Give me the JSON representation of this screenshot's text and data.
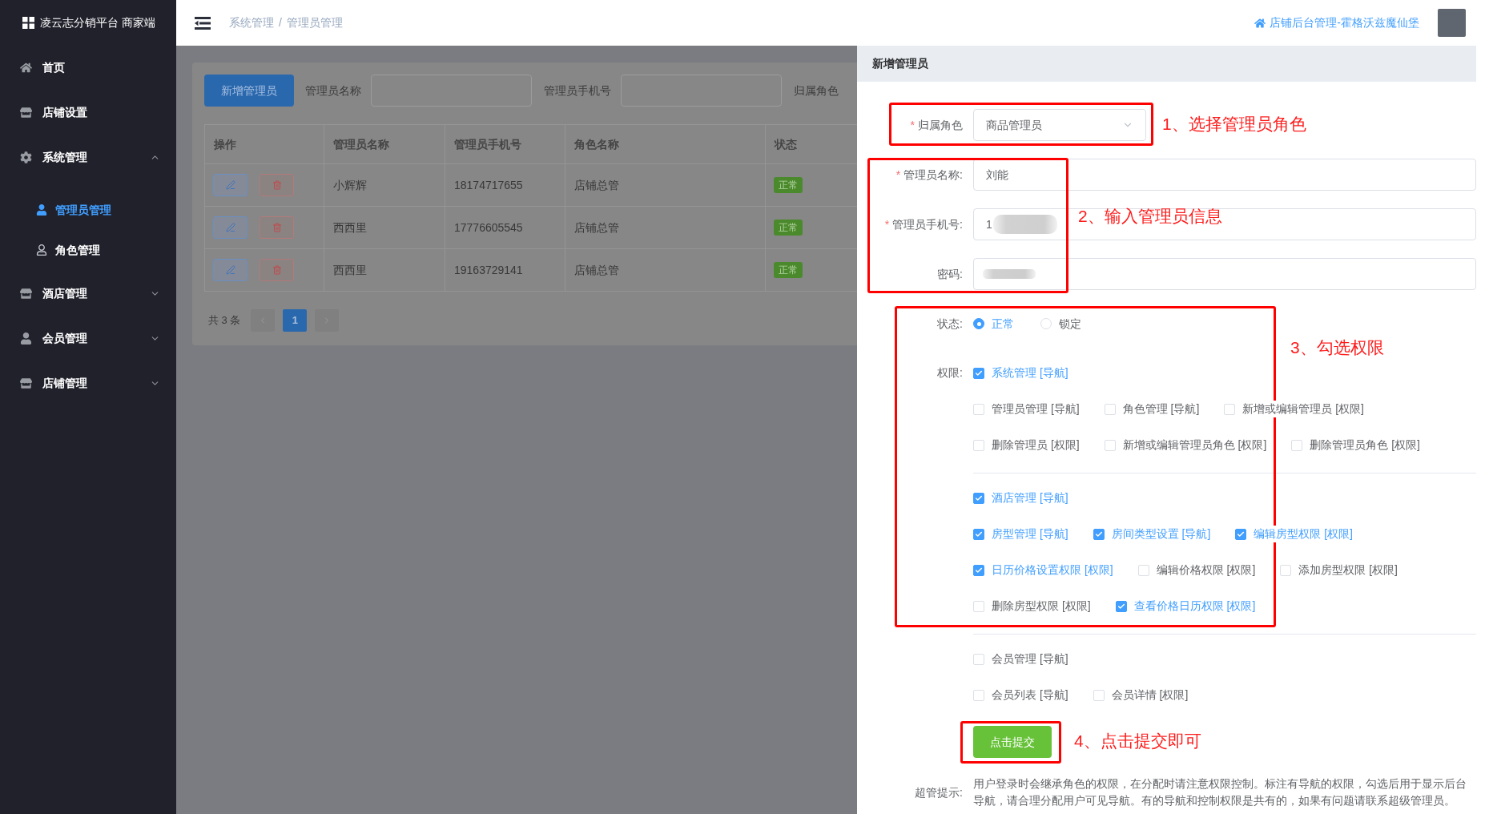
{
  "sidebar": {
    "app_title": "凌云志分销平台 商家端",
    "items": [
      {
        "label": "首页",
        "kind": "link"
      },
      {
        "label": "店铺设置",
        "kind": "link"
      },
      {
        "label": "系统管理",
        "kind": "submenu",
        "expanded": true,
        "children": [
          {
            "label": "管理员管理",
            "selected": true
          },
          {
            "label": "角色管理",
            "selected": false
          }
        ]
      },
      {
        "label": "酒店管理",
        "kind": "submenu",
        "expanded": false
      },
      {
        "label": "会员管理",
        "kind": "submenu",
        "expanded": false
      },
      {
        "label": "店铺管理",
        "kind": "submenu",
        "expanded": false
      }
    ]
  },
  "header": {
    "breadcrumb": {
      "items": [
        "系统管理",
        "管理员管理"
      ],
      "separator": "/"
    },
    "shop_link": "店铺后台管理-霍格沃兹魔仙堡"
  },
  "main": {
    "add_button": "新增管理员",
    "filters": [
      {
        "label": "管理员名称",
        "kind": "input"
      },
      {
        "label": "管理员手机号",
        "kind": "input"
      },
      {
        "label": "归属角色",
        "kind": "label"
      }
    ],
    "table": {
      "columns": [
        "操作",
        "管理员名称",
        "管理员手机号",
        "角色名称",
        "状态"
      ],
      "rows": [
        {
          "name": "小辉辉",
          "phone": "18174717655",
          "role": "店铺总管",
          "status": "正常"
        },
        {
          "name": "西西里",
          "phone": "17776605545",
          "role": "店铺总管",
          "status": "正常"
        },
        {
          "name": "西西里",
          "phone": "19163729141",
          "role": "店铺总管",
          "status": "正常"
        }
      ]
    },
    "pagination": {
      "total": "共 3 条",
      "pages": [
        {
          "label": "1",
          "selected": true
        }
      ]
    }
  },
  "drawer": {
    "title": "新增管理员",
    "fields": [
      {
        "kind": "select",
        "label": "归属角色",
        "required_mark": "*",
        "value": "商品管理员"
      },
      {
        "kind": "input",
        "label": "管理员名称:",
        "required_mark": "*",
        "value": "刘能"
      },
      {
        "kind": "input",
        "label": "管理员手机号:",
        "required_mark": "*",
        "value": "1",
        "redacted": true
      },
      {
        "kind": "input",
        "label": "密码:",
        "redacted": true
      }
    ],
    "status": {
      "label": "状态:",
      "options": [
        {
          "label": "正常",
          "selected": true
        },
        {
          "label": "锁定",
          "selected": false
        }
      ]
    },
    "permissions": {
      "label": "权限:",
      "groups": [
        {
          "label": "系统管理 [导航]",
          "checked": true,
          "children": [
            {
              "label": "管理员管理 [导航]",
              "checked": false
            },
            {
              "label": "角色管理 [导航]",
              "checked": false
            },
            {
              "label": "新增或编辑管理员 [权限]",
              "checked": false
            },
            {
              "label": "删除管理员 [权限]",
              "checked": false
            },
            {
              "label": "新增或编辑管理员角色 [权限]",
              "checked": false
            },
            {
              "label": "删除管理员角色 [权限]",
              "checked": false
            }
          ]
        },
        {
          "label": "酒店管理 [导航]",
          "checked": true,
          "children": [
            {
              "label": "房型管理 [导航]",
              "checked": true
            },
            {
              "label": "房间类型设置 [导航]",
              "checked": true
            },
            {
              "label": "编辑房型权限 [权限]",
              "checked": true
            },
            {
              "label": "日历价格设置权限 [权限]",
              "checked": true
            },
            {
              "label": "编辑价格权限 [权限]",
              "checked": false
            },
            {
              "label": "添加房型权限 [权限]",
              "checked": false
            },
            {
              "label": "删除房型权限 [权限]",
              "checked": false
            },
            {
              "label": "查看价格日历权限 [权限]",
              "checked": true
            }
          ]
        },
        {
          "label": "会员管理 [导航]",
          "checked": false,
          "children": [
            {
              "label": "会员列表 [导航]",
              "checked": false
            },
            {
              "label": "会员详情 [权限]",
              "checked": false
            }
          ]
        }
      ]
    },
    "submit_button": "点击提交",
    "tip": {
      "label": "超管提示:",
      "text": "用户登录时会继承角色的权限，在分配时请注意权限控制。标注有导航的权限，勾选后用于显示后台导航，请合理分配用户可见导航。有的导航和控制权限是共有的，如果有问题请联系超级管理员。"
    }
  },
  "annotations": [
    {
      "text": "1、选择管理员角色"
    },
    {
      "text": "2、输入管理员信息"
    },
    {
      "text": "3、勾选权限"
    },
    {
      "text": "4、点击提交即可"
    }
  ]
}
